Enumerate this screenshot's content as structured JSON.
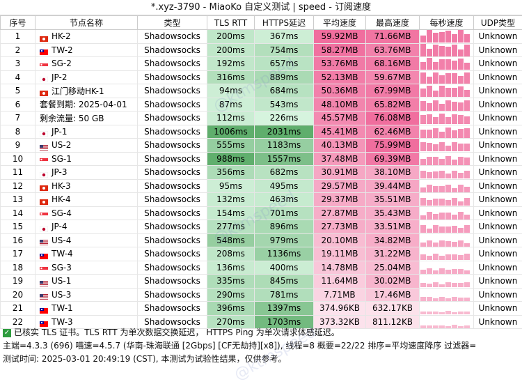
{
  "title": "*.xyz-3790 - MiaoKo 自定义测试 | speed - 订阅速度",
  "headers": [
    "序号",
    "节点名称",
    "类型",
    "TLS RTT",
    "HTTPS延迟",
    "平均速度",
    "最高速度",
    "每秒速度",
    "UDP类型"
  ],
  "rows": [
    {
      "idx": "1",
      "flag": "hk",
      "name": "HK-2",
      "type": "Shadowsocks",
      "tls": "200ms",
      "https": "367ms",
      "avg": "59.92MB",
      "max": "71.66MB",
      "udp": "Unknown"
    },
    {
      "idx": "2",
      "flag": "tw",
      "name": "TW-2",
      "type": "Shadowsocks",
      "tls": "200ms",
      "https": "754ms",
      "avg": "58.27MB",
      "max": "63.76MB",
      "udp": "Unknown"
    },
    {
      "idx": "3",
      "flag": "sg",
      "name": "SG-2",
      "type": "Shadowsocks",
      "tls": "192ms",
      "https": "657ms",
      "avg": "53.76MB",
      "max": "68.16MB",
      "udp": "Unknown"
    },
    {
      "idx": "4",
      "flag": "jp",
      "name": "JP-2",
      "type": "Shadowsocks",
      "tls": "316ms",
      "https": "889ms",
      "avg": "52.13MB",
      "max": "59.67MB",
      "udp": "Unknown"
    },
    {
      "idx": "5",
      "flag": "hk",
      "name": "江门移动HK-1",
      "type": "Shadowsocks",
      "tls": "94ms",
      "https": "684ms",
      "avg": "50.36MB",
      "max": "67.99MB",
      "udp": "Unknown"
    },
    {
      "idx": "6",
      "flag": "",
      "name": "套餐到期: 2025-04-01",
      "type": "Shadowsocks",
      "tls": "87ms",
      "https": "543ms",
      "avg": "48.10MB",
      "max": "65.82MB",
      "udp": "Unknown"
    },
    {
      "idx": "7",
      "flag": "",
      "name": "剩余流量: 50 GB",
      "type": "Shadowsocks",
      "tls": "112ms",
      "https": "226ms",
      "avg": "45.57MB",
      "max": "76.08MB",
      "udp": "Unknown"
    },
    {
      "idx": "8",
      "flag": "jp",
      "name": "JP-1",
      "type": "Shadowsocks",
      "tls": "1006ms",
      "https": "2031ms",
      "avg": "45.41MB",
      "max": "62.46MB",
      "udp": "Unknown"
    },
    {
      "idx": "9",
      "flag": "us",
      "name": "US-2",
      "type": "Shadowsocks",
      "tls": "555ms",
      "https": "1183ms",
      "avg": "40.13MB",
      "max": "75.99MB",
      "udp": "Unknown"
    },
    {
      "idx": "10",
      "flag": "sg",
      "name": "SG-1",
      "type": "Shadowsocks",
      "tls": "988ms",
      "https": "1557ms",
      "avg": "37.48MB",
      "max": "69.39MB",
      "udp": "Unknown"
    },
    {
      "idx": "11",
      "flag": "jp",
      "name": "JP-3",
      "type": "Shadowsocks",
      "tls": "356ms",
      "https": "682ms",
      "avg": "30.91MB",
      "max": "38.10MB",
      "udp": "Unknown"
    },
    {
      "idx": "12",
      "flag": "hk",
      "name": "HK-3",
      "type": "Shadowsocks",
      "tls": "95ms",
      "https": "495ms",
      "avg": "29.57MB",
      "max": "39.44MB",
      "udp": "Unknown"
    },
    {
      "idx": "13",
      "flag": "hk",
      "name": "HK-4",
      "type": "Shadowsocks",
      "tls": "132ms",
      "https": "463ms",
      "avg": "29.37MB",
      "max": "35.51MB",
      "udp": "Unknown"
    },
    {
      "idx": "14",
      "flag": "sg",
      "name": "SG-4",
      "type": "Shadowsocks",
      "tls": "154ms",
      "https": "701ms",
      "avg": "27.87MB",
      "max": "35.43MB",
      "udp": "Unknown"
    },
    {
      "idx": "15",
      "flag": "jp",
      "name": "JP-4",
      "type": "Shadowsocks",
      "tls": "277ms",
      "https": "896ms",
      "avg": "27.73MB",
      "max": "33.51MB",
      "udp": "Unknown"
    },
    {
      "idx": "16",
      "flag": "us",
      "name": "US-4",
      "type": "Shadowsocks",
      "tls": "548ms",
      "https": "979ms",
      "avg": "20.10MB",
      "max": "34.82MB",
      "udp": "Unknown"
    },
    {
      "idx": "17",
      "flag": "tw",
      "name": "TW-4",
      "type": "Shadowsocks",
      "tls": "208ms",
      "https": "1136ms",
      "avg": "19.11MB",
      "max": "31.22MB",
      "udp": "Unknown"
    },
    {
      "idx": "18",
      "flag": "sg",
      "name": "SG-3",
      "type": "Shadowsocks",
      "tls": "136ms",
      "https": "400ms",
      "avg": "14.78MB",
      "max": "25.04MB",
      "udp": "Unknown"
    },
    {
      "idx": "19",
      "flag": "us",
      "name": "US-1",
      "type": "Shadowsocks",
      "tls": "335ms",
      "https": "845ms",
      "avg": "11.64MB",
      "max": "30.02MB",
      "udp": "Unknown"
    },
    {
      "idx": "20",
      "flag": "us",
      "name": "US-3",
      "type": "Shadowsocks",
      "tls": "290ms",
      "https": "781ms",
      "avg": "7.71MB",
      "max": "17.46MB",
      "udp": "Unknown"
    },
    {
      "idx": "21",
      "flag": "tw",
      "name": "TW-1",
      "type": "Shadowsocks",
      "tls": "396ms",
      "https": "1397ms",
      "avg": "374.96KB",
      "max": "632.17KB",
      "udp": "Unknown"
    },
    {
      "idx": "22",
      "flag": "tw",
      "name": "TW-3",
      "type": "Shadowsocks",
      "tls": "270ms",
      "https": "1703ms",
      "avg": "373.32KB",
      "max": "811.12KB",
      "udp": "Unknown"
    }
  ],
  "footer": {
    "line1": "已核实 TLS 证书。TLS RTT 为单次数据交换延迟， HTTPS Ping 为单次请求体感延迟。",
    "line2": "主端=4.3.3 (696) 喵速=4.5.7 (华南-珠海联通 [2Gbps] [CF无劫持][x8]), 线程=8 概要=22/22 排序=平均速度降序 过滤器=",
    "line3": "测试时间: 2025-03-01 20:49:19 (CST), 本测试为试验性结果，仅供参考。"
  },
  "watermark": "@ktmspeed",
  "colors": {
    "latency_light": "#d8f5e0",
    "latency_dark": "#5fae6c",
    "speed_light": "#fce3ec",
    "speed_dark": "#f06e9e",
    "check_green": "#2e9c3e"
  },
  "flag_icons": {
    "hk": "hong-kong-flag-icon",
    "tw": "taiwan-flag-icon",
    "sg": "singapore-flag-icon",
    "jp": "japan-flag-icon",
    "us": "usa-flag-icon"
  }
}
